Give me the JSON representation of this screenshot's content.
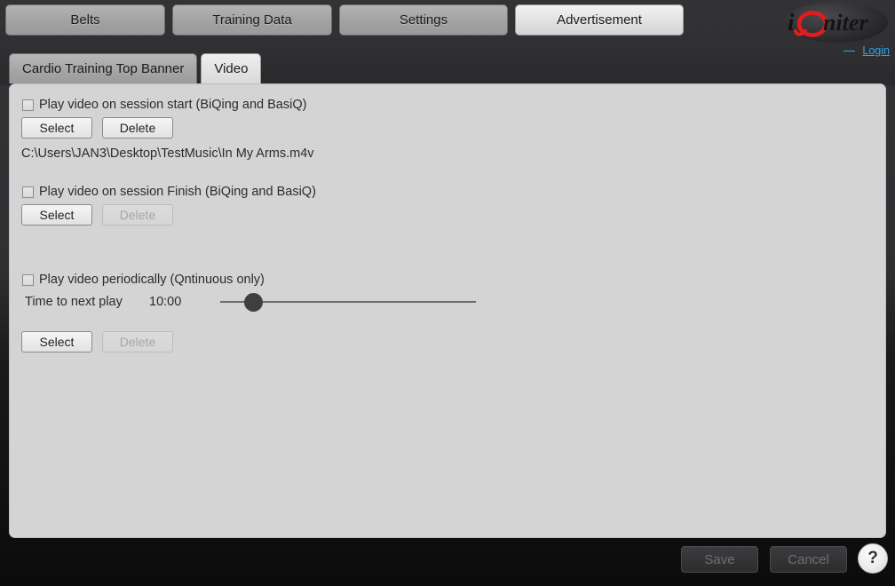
{
  "header": {
    "main_tabs": [
      {
        "label": "Belts",
        "active": false
      },
      {
        "label": "Training Data",
        "active": false
      },
      {
        "label": "Settings",
        "active": false
      },
      {
        "label": "Advertisement",
        "active": true
      }
    ],
    "logo_text": "iQniter",
    "logo_accent_color": "#e01d1d",
    "login_label": "Login",
    "login_color": "#2aa7e8"
  },
  "sub_tabs": [
    {
      "label": "Cardio Training Top Banner",
      "active": false
    },
    {
      "label": "Video",
      "active": true
    }
  ],
  "main": {
    "session_start": {
      "checkbox_label": "Play video on session start (BiQing and BasiQ)",
      "checked": false,
      "select_label": "Select",
      "delete_label": "Delete",
      "delete_disabled": false,
      "file_path": "C:\\Users\\JAN3\\Desktop\\TestMusic\\In My Arms.m4v"
    },
    "session_finish": {
      "checkbox_label": "Play video on session Finish (BiQing and BasiQ)",
      "checked": false,
      "select_label": "Select",
      "delete_label": "Delete",
      "delete_disabled": true
    },
    "periodic": {
      "checkbox_label": "Play video periodically (Qntinuous only)",
      "checked": false,
      "slider_label": "Time to next play",
      "slider_value": "10:00",
      "slider_percent": 10,
      "select_label": "Select",
      "delete_label": "Delete",
      "delete_disabled": true
    }
  },
  "footer": {
    "save_label": "Save",
    "save_disabled": true,
    "cancel_label": "Cancel",
    "cancel_disabled": true,
    "help_label": "?"
  }
}
